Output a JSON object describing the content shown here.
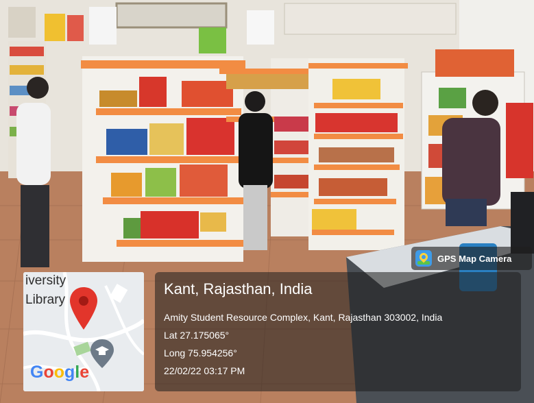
{
  "overlay": {
    "app_badge": "GPS Map Camera",
    "map_labels": [
      "iversity",
      "Library"
    ],
    "map_brand": "Google",
    "location_title": "Kant, Rajasthan, India",
    "address": "Amity Student Resource Complex, Kant, Rajasthan 303002, India",
    "latitude": "Lat 27.175065°",
    "longitude": "Long 75.954256°",
    "datetime": "22/02/22 03:17 PM"
  },
  "icons": {
    "badge": "gps-map-camera-icon",
    "pin": "map-pin-icon",
    "school": "graduation-cap-icon"
  },
  "colors": {
    "pin": "#e2352b",
    "google_blue": "#4285f4",
    "google_red": "#ea4335",
    "google_yellow": "#fbbc05",
    "google_green": "#34a853",
    "shelf_accent": "#f28c43"
  }
}
